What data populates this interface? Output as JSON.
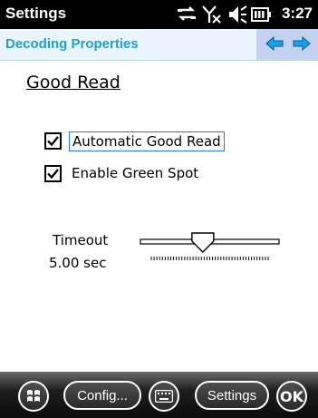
{
  "status_bar": {
    "app_title": "Settings",
    "time": "3:27",
    "icons": [
      "connection-icon",
      "no-signal-icon",
      "volume-icon",
      "battery-icon"
    ]
  },
  "header": {
    "title": "Decoding Properties",
    "nav": [
      "arrow-left-icon",
      "arrow-right-icon"
    ]
  },
  "section": {
    "title": "Good Read"
  },
  "options": [
    {
      "label": "Automatic Good Read",
      "checked": true,
      "focused": true
    },
    {
      "label": "Enable Green Spot",
      "checked": true,
      "focused": false
    }
  ],
  "timeout": {
    "label": "Timeout",
    "value": "5.00 sec",
    "slider_level": 0.45
  },
  "bottom_bar": {
    "start_icon": "windows-start-icon",
    "config_label": "Config...",
    "keyboard_icon": "keyboard-icon",
    "settings_label": "Settings",
    "ok_label": "OK"
  },
  "colors": {
    "header_title": "#1fa0cf",
    "nav_bg": "#c4d2f2",
    "arrow": "#18a0ee"
  }
}
